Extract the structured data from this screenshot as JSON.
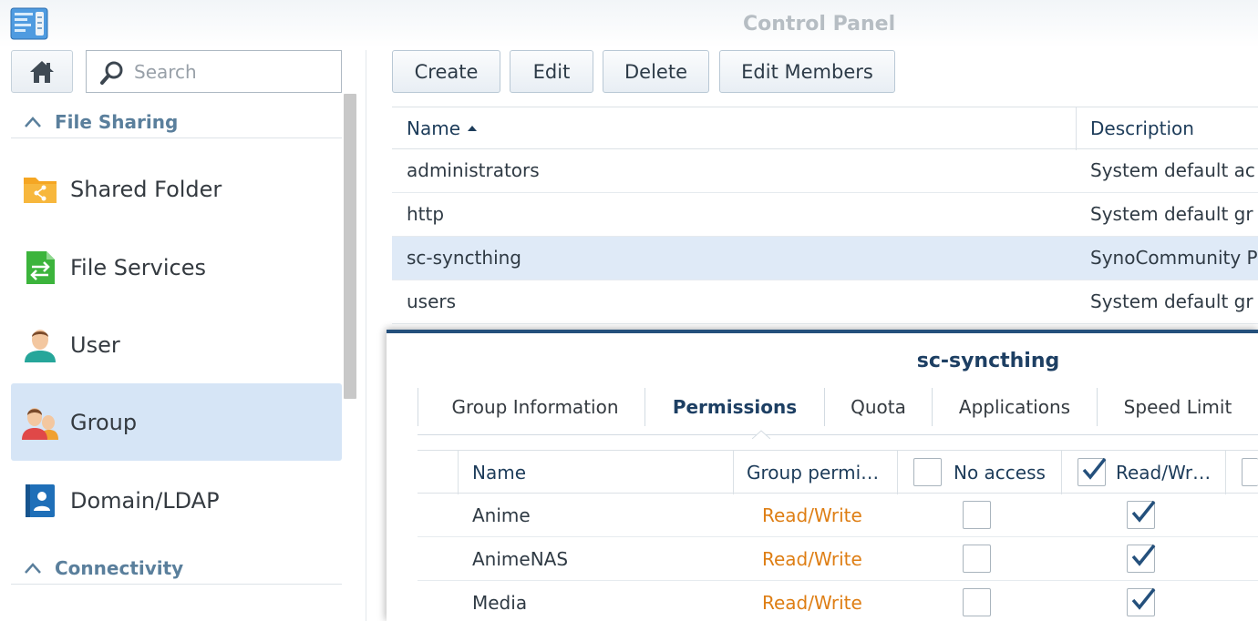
{
  "window": {
    "title": "Control Panel",
    "app_icon": "control-panel-icon"
  },
  "sidebar": {
    "home_icon": "home-icon",
    "search": {
      "placeholder": "Search",
      "icon": "search-icon"
    },
    "sections": [
      {
        "label": "File Sharing",
        "icon": "chevron-up-icon"
      },
      {
        "label": "Connectivity",
        "icon": "chevron-up-icon"
      }
    ],
    "items": [
      {
        "label": "Shared Folder",
        "icon": "shared-folder-icon"
      },
      {
        "label": "File Services",
        "icon": "file-services-icon"
      },
      {
        "label": "User",
        "icon": "user-icon"
      },
      {
        "label": "Group",
        "icon": "group-icon",
        "selected": true
      },
      {
        "label": "Domain/LDAP",
        "icon": "domain-ldap-icon"
      }
    ]
  },
  "toolbar": {
    "create": "Create",
    "edit": "Edit",
    "delete": "Delete",
    "edit_members": "Edit Members"
  },
  "grid": {
    "columns": {
      "name": "Name",
      "description": "Description",
      "sort": "ascending"
    },
    "rows": [
      {
        "name": "administrators",
        "description": "System default ac"
      },
      {
        "name": "http",
        "description": "System default gr"
      },
      {
        "name": "sc-syncthing",
        "description": "SynoCommunity P",
        "selected": true
      },
      {
        "name": "users",
        "description": "System default gr"
      }
    ]
  },
  "dialog": {
    "title": "sc-syncthing",
    "tabs": [
      {
        "label": "Group Information"
      },
      {
        "label": "Permissions",
        "active": true
      },
      {
        "label": "Quota"
      },
      {
        "label": "Applications"
      },
      {
        "label": "Speed Limit"
      }
    ],
    "permissions": {
      "columns": {
        "name": "Name",
        "group_permission": "Group permi…",
        "no_access": "No access",
        "read_write": "Read/Wr…"
      },
      "header_checks": {
        "no_access": false,
        "read_write": true,
        "read_only": false
      },
      "rows": [
        {
          "name": "Anime",
          "permission": "Read/Write",
          "no_access": false,
          "read_write": true
        },
        {
          "name": "AnimeNAS",
          "permission": "Read/Write",
          "no_access": false,
          "read_write": true
        },
        {
          "name": "Media",
          "permission": "Read/Write",
          "no_access": false,
          "read_write": true
        }
      ]
    }
  },
  "colors": {
    "accent": "#24507c",
    "selection": "#d6e5f6",
    "permission_text": "#de7e14",
    "section_label": "#5a7f9c"
  }
}
